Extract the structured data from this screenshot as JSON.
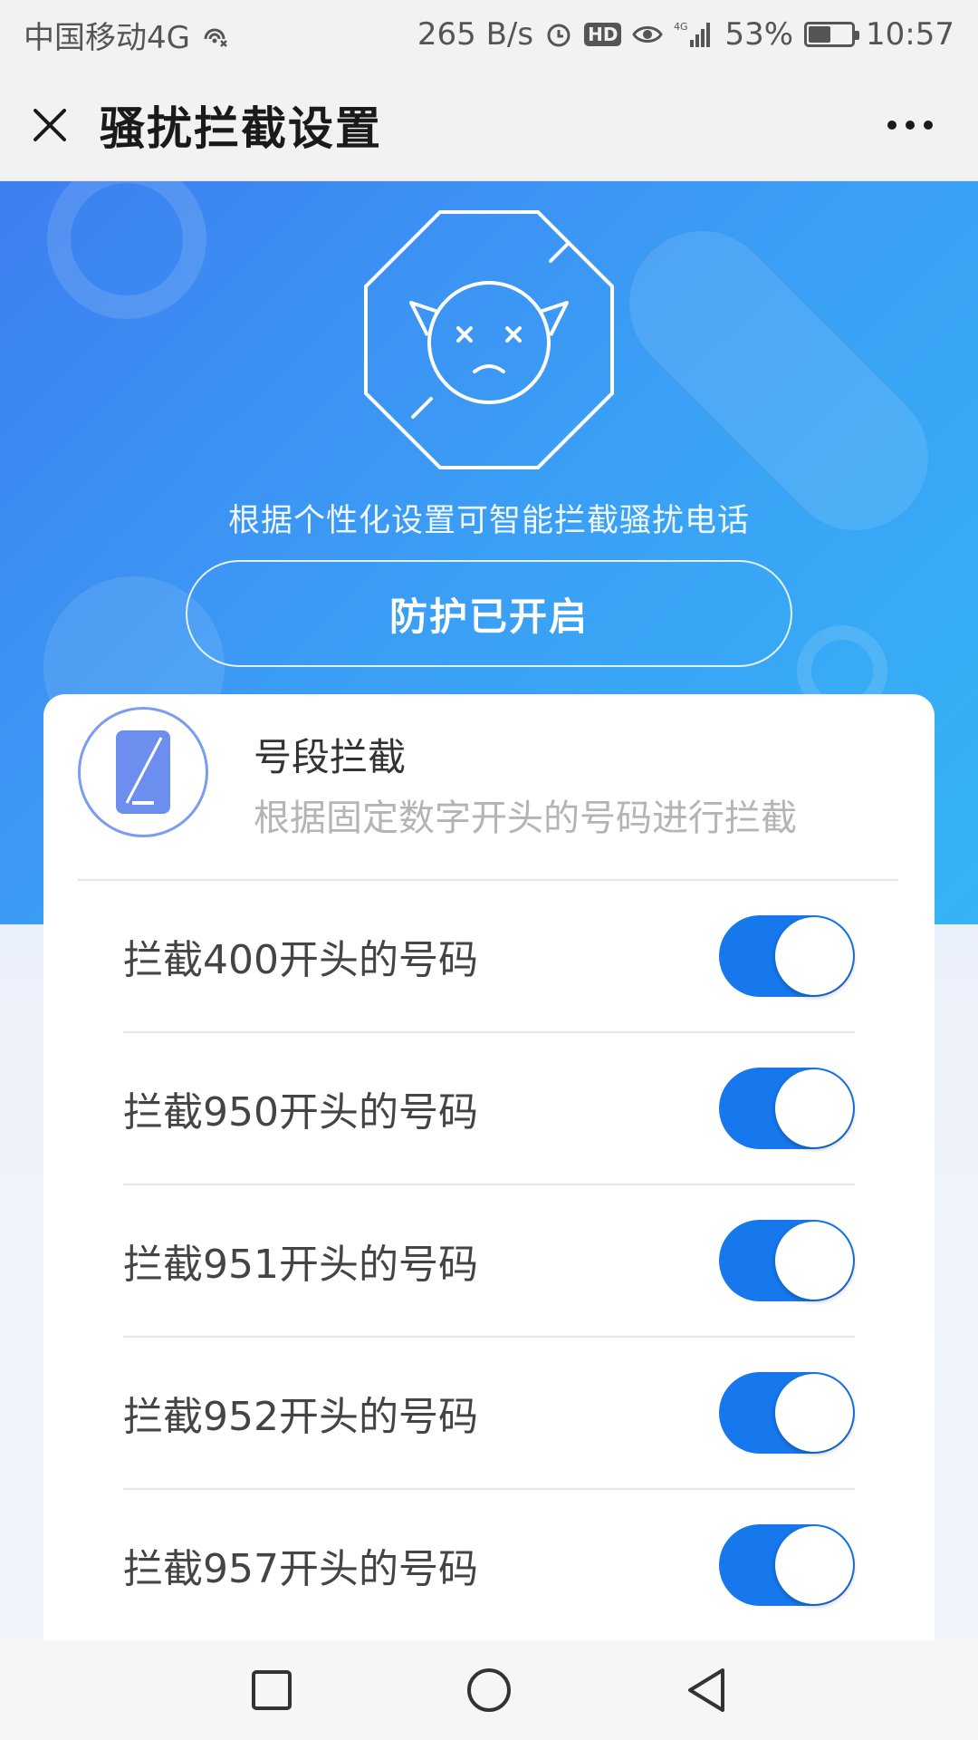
{
  "status_bar": {
    "carrier": "中国移动4G",
    "speed": "265 B/s",
    "hd": "HD",
    "network": "4G",
    "battery": "53%",
    "battery_level": 0.53,
    "time": "10:57"
  },
  "title_bar": {
    "title": "骚扰拦截设置",
    "close_icon": "close-icon",
    "more_icon": "more-icon"
  },
  "hero": {
    "description": "根据个性化设置可智能拦截骚扰电话",
    "protect_button": "防护已开启"
  },
  "card": {
    "title": "号段拦截",
    "subtitle": "根据固定数字开头的号码进行拦截",
    "icon": "phone-icon",
    "rows": [
      {
        "label": "拦截400开头的号码",
        "enabled": true
      },
      {
        "label": "拦截950开头的号码",
        "enabled": true
      },
      {
        "label": "拦截951开头的号码",
        "enabled": true
      },
      {
        "label": "拦截952开头的号码",
        "enabled": true
      },
      {
        "label": "拦截957开头的号码",
        "enabled": true
      }
    ]
  },
  "colors": {
    "accent": "#1778ee",
    "hero_start": "#3d7ff0",
    "hero_end": "#35b3f6"
  }
}
